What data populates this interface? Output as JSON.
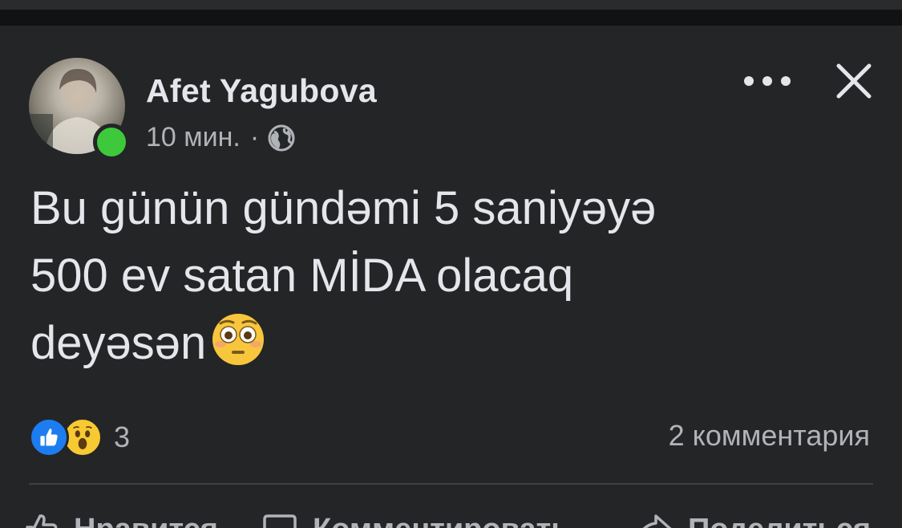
{
  "post": {
    "author": "Afet Yagubova",
    "time": "10 мин.",
    "separator": "·",
    "privacy_icon": "globe-icon",
    "text": "Bu günün gündəmi 5 saniyəyə\n500 ev satan MİDA olacaq\ndeyəsən",
    "emoji": "flushed-face"
  },
  "header_actions": {
    "more_icon": "more-dots-icon",
    "close_icon": "close-icon"
  },
  "reactions": {
    "types": [
      "like",
      "wow"
    ],
    "count": "3"
  },
  "comments": {
    "count_label": "2 комментария"
  },
  "actions": {
    "like_label": "Нравится",
    "comment_label": "Комментировать",
    "share_label": "Поделиться"
  },
  "colors": {
    "card_bg": "#242526",
    "text_primary": "#e4e6eb",
    "text_secondary": "#b0b3b8",
    "online": "#3dc93b",
    "like_blue": "#1d7df0",
    "wow_yellow": "#f7c933"
  }
}
